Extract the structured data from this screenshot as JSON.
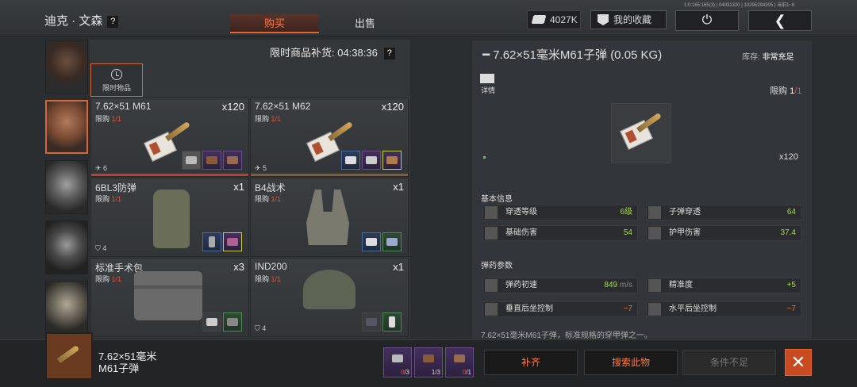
{
  "header": {
    "trader_name": "迪克 · 文森",
    "help": "?",
    "tabs": [
      {
        "label": "购买"
      },
      {
        "label": "出售"
      }
    ],
    "money": "4027K",
    "favorites_label": "我的收藏",
    "power_icon": "power-icon",
    "back_icon": "back-arrow-icon",
    "top_info": "1:0:165:165(3) | 04031320 | 10295294205 | 当前1~6"
  },
  "left": {
    "restock_label": "限时商品补货: 04:38:36",
    "limited_goods_label": "限时物品",
    "items": [
      {
        "name": "7.62×51 M61",
        "limit_prefix": "限购 ",
        "limit": "1/1",
        "qty": "x120",
        "stat": "6",
        "bar_color": "#c04030"
      },
      {
        "name": "7.62×51 M62",
        "limit_prefix": "限购 ",
        "limit": "1/1",
        "qty": "x120",
        "stat": "5",
        "bar_color": "#8a5a30"
      },
      {
        "name": "6BL3防弹",
        "limit_prefix": "限购 ",
        "limit": "1/1",
        "qty": "x1",
        "stat": "4",
        "bar_color": ""
      },
      {
        "name": "B4战术",
        "limit_prefix": "限购 ",
        "limit": "1/1",
        "qty": "x1",
        "stat": "",
        "bar_color": ""
      },
      {
        "name": "标准手术包",
        "limit_prefix": "限购 ",
        "limit": "1/1",
        "qty": "x3",
        "stat": "",
        "bar_color": ""
      },
      {
        "name": "IND200",
        "limit_prefix": "限购 ",
        "limit": "1/1",
        "qty": "x1",
        "stat": "4",
        "bar_color": ""
      }
    ]
  },
  "right": {
    "title": "7.62×51毫米M61子弹 (0.05 KG)",
    "stock_prefix": "库存: ",
    "stock_value": "非常充足",
    "detail_label": "详情",
    "limit_prefix": "限购 ",
    "limit_used": "1",
    "limit_total": "/1",
    "preview_qty": "x120",
    "basic_info_label": "基本信息",
    "basic_stats": [
      {
        "label": "穿透等级",
        "value": "6级",
        "icon": "penetration-icon"
      },
      {
        "label": "子弹穿透",
        "value": "64",
        "icon": "bullet-penetration-icon"
      },
      {
        "label": "基础伤害",
        "value": "54",
        "icon": "damage-icon"
      },
      {
        "label": "护甲伤害",
        "value": "37.4",
        "icon": "armor-damage-icon"
      }
    ],
    "ammo_params_label": "弹药参数",
    "ammo_stats": [
      {
        "label": "弹药初速",
        "value": "849",
        "unit": " m/s",
        "color": "green",
        "icon": "velocity-icon"
      },
      {
        "label": "精准度",
        "value": "+5",
        "unit": "",
        "color": "green",
        "icon": "accuracy-icon"
      },
      {
        "label": "垂直后坐控制",
        "value": "−7",
        "unit": "",
        "color": "orange",
        "icon": "vertical-recoil-icon"
      },
      {
        "label": "水平后坐控制",
        "value": "−7",
        "unit": "",
        "color": "orange",
        "icon": "horizontal-recoil-icon"
      }
    ],
    "description": "7.62×51毫米M61子弹，标准规格的穿甲弹之一。"
  },
  "bottom": {
    "selected_name_line1": "7.62×51毫米",
    "selected_name_line2": "M61子弹",
    "requirements": [
      {
        "have": "0",
        "need": "/3"
      },
      {
        "have": "1",
        "need": "/3"
      },
      {
        "have": "0",
        "need": "/1"
      }
    ],
    "replenish_label": "补齐",
    "search_label": "搜索此物",
    "condition_label": "条件不足",
    "close_icon": "close-icon"
  }
}
